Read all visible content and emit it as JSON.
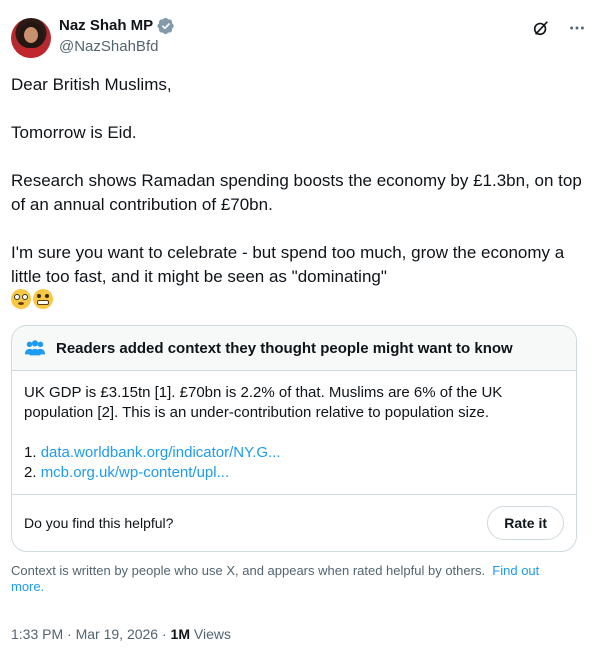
{
  "author": {
    "display_name": "Naz Shah MP",
    "handle": "@NazShahBfd",
    "verified_badge_color": "#829aab"
  },
  "top_icons": [
    "grok-slash-icon",
    "more-icon"
  ],
  "tweet": {
    "line1": "Dear British Muslims,",
    "line2": "Tomorrow is Eid.",
    "line3": "Research shows Ramadan spending boosts the economy by £1.3bn, on top of an annual contribution of £70bn.",
    "line4": "I'm sure you want to celebrate - but spend too much, grow the economy a little too fast, and it might be seen as \"dominating\"",
    "emojis": [
      "flushed-face",
      "grimacing-face"
    ]
  },
  "community_note": {
    "title": "Readers added context they thought people might want to know",
    "body": "UK GDP is £3.15tn [1]. £70bn is 2.2% of that. Muslims are 6% of the UK population [2]. This is an under-contribution relative to population size.",
    "links": [
      {
        "index": "1.",
        "text": "data.worldbank.org/indicator/NY.G..."
      },
      {
        "index": "2.",
        "text": "mcb.org.uk/wp-content/upl..."
      }
    ],
    "helpful_question": "Do you find this helpful?",
    "rate_button": "Rate it"
  },
  "context_info": {
    "text": "Context is written by people who use X, and appears when rated helpful by others.",
    "link": "Find out more."
  },
  "meta": {
    "time": "1:33 PM",
    "separator": "·",
    "date": "Mar 19, 2026",
    "views_count": "1M",
    "views_label": "Views"
  },
  "colors": {
    "accent": "#1d9bf0",
    "secondary_text": "#536471",
    "border": "#cfd9de"
  }
}
